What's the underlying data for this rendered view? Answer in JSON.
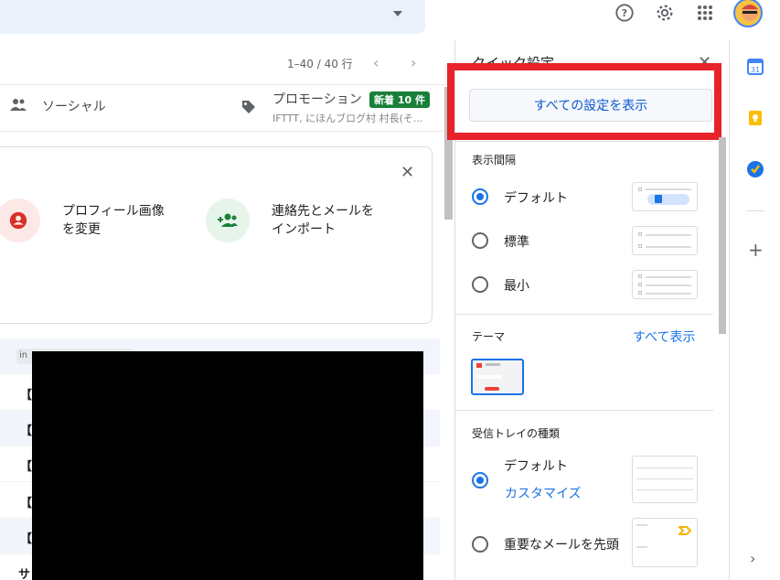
{
  "topbar": {
    "help_icon": "help-circle-icon",
    "settings_icon": "gear-icon",
    "apps_icon": "apps-grid-icon",
    "avatar_icon": "avatar"
  },
  "list": {
    "pager_text": "1–40 / 40 行",
    "tabs": {
      "social_label": "ソーシャル",
      "promo_label": "プロモーション",
      "promo_badge": "新着 10 件",
      "promo_sub": "IFTTT, にほんブログ村 村長(そ..."
    },
    "card": {
      "action1": [
        "プロフィール画像",
        "を変更"
      ],
      "action2": [
        "連絡先とメールを",
        "インポート"
      ]
    },
    "label_chip": "in",
    "rows": [
      "【",
      "【",
      "【",
      "【",
      "【",
      "サ"
    ]
  },
  "quick_settings": {
    "title": "クイック設定",
    "all_settings_button": "すべての設定を表示",
    "density": {
      "title": "表示間隔",
      "options": [
        "デフォルト",
        "標準",
        "最小"
      ],
      "selected_index": 0
    },
    "theme": {
      "title": "テーマ",
      "view_all": "すべて表示"
    },
    "inbox_type": {
      "title": "受信トレイの種類",
      "options": [
        {
          "label": "デフォルト",
          "customize": "カスタマイズ"
        },
        {
          "label": "重要なメールを先頭"
        }
      ],
      "selected_index": 0
    }
  },
  "colors": {
    "accent": "#1a73e8",
    "highlight_box": "#e8232a",
    "badge_green": "#188038"
  }
}
